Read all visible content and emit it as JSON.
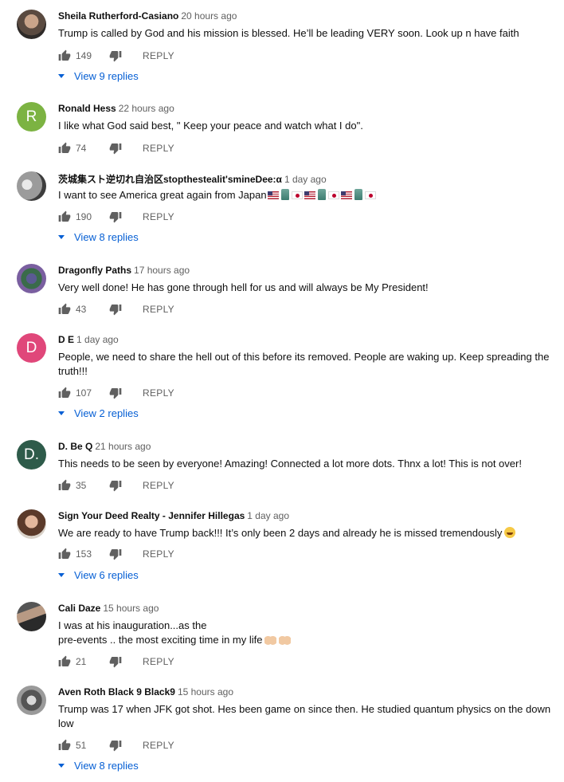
{
  "colors": {
    "link": "#065fd4",
    "meta": "#606060",
    "text": "#0f0f0f"
  },
  "reply_label": "REPLY",
  "comments": [
    {
      "author": "Sheila Rutherford-Casiano",
      "time": "20 hours ago",
      "text": "Trump is called by God and his mission is blessed. He’ll be leading VERY soon. Look up n have faith",
      "likes": "149",
      "replies": "View 9 replies",
      "avatar": "photo"
    },
    {
      "author": "Ronald Hess",
      "time": "22 hours ago",
      "text": "I like what God said best, \" Keep your peace and watch what I do\".",
      "likes": "74",
      "avatar_letter": "R",
      "avatar_color": "#7cb342"
    },
    {
      "author": "茨城集スト逆切れ自治区stopthestealit'smineDee:α",
      "time": "1 day ago",
      "text": "I want to see America great again from Japan",
      "likes": "190",
      "replies": "View 8 replies",
      "avatar": "photo"
    },
    {
      "author": "Dragonfly Paths",
      "time": "17 hours ago",
      "text": "Very well done! He has gone through hell for us and will always be My President!",
      "likes": "43",
      "avatar": "photo"
    },
    {
      "author": "D E",
      "time": "1 day ago",
      "text": "People, we need to share the hell out of this before its removed. People are waking up. Keep spreading the truth!!!",
      "likes": "107",
      "replies": "View 2 replies",
      "avatar_letter": "D",
      "avatar_color": "#e0477a"
    },
    {
      "author": "D. Be Q",
      "time": "21 hours ago",
      "text": "This needs to be seen by everyone! Amazing! Connected a lot more dots. Thnx a lot!  This is not over!",
      "likes": "35",
      "avatar_letter": "D.",
      "avatar_color": "#2e5b4a"
    },
    {
      "author": "Sign Your Deed Realty - Jennifer Hillegas",
      "time": "1 day ago",
      "text": "We are ready to have Trump back!!! It’s only been 2 days and already he is missed tremendously",
      "likes": "153",
      "replies": "View 6 replies",
      "avatar": "photo"
    },
    {
      "author": "Cali Daze",
      "time": "15 hours ago",
      "text_line1": "I was at his inauguration...as the",
      "text_line2": "pre-events  .. the most exciting time in my life",
      "likes": "21",
      "avatar": "photo"
    },
    {
      "author": "Aven Roth Black 9 Black9",
      "time": "15 hours ago",
      "text": "Trump was 17 when JFK got shot. Hes been game on since then. He studied quantum physics on the down low",
      "likes": "51",
      "replies": "View 8 replies",
      "avatar": "photo"
    }
  ]
}
